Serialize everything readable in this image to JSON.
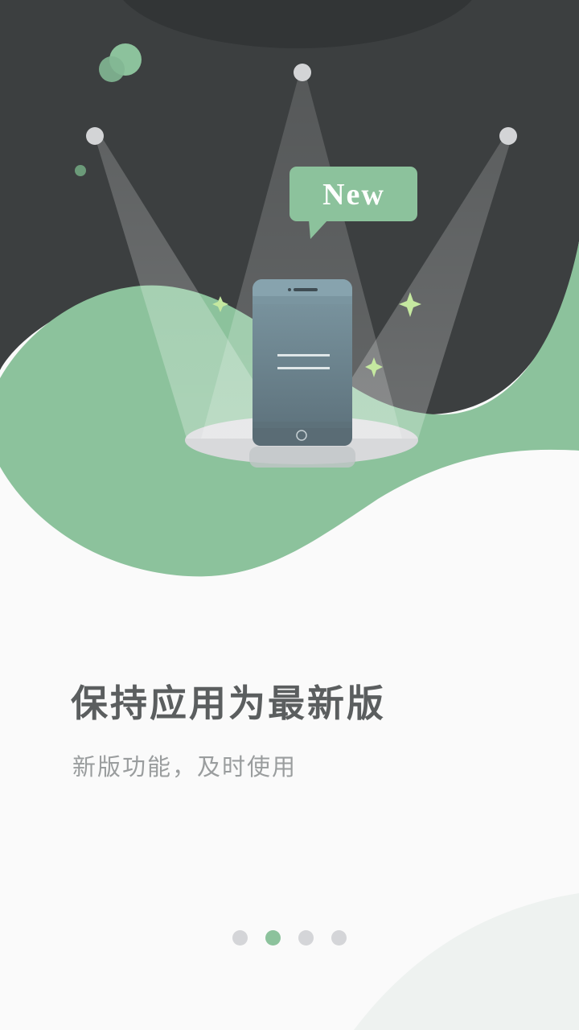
{
  "illustration": {
    "badge_text": "New"
  },
  "onboarding": {
    "title": "保持应用为最新版",
    "subtitle": "新版功能，及时使用"
  },
  "pager": {
    "page_count": 4,
    "active_index": 1
  },
  "colors": {
    "dark_background": "#3c3f40",
    "accent_green": "#8cc29c",
    "text_primary": "#5b5e5f",
    "text_secondary": "#9a9d9e",
    "dot_inactive": "#d4d5d8"
  }
}
